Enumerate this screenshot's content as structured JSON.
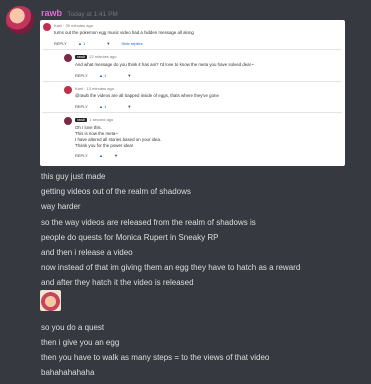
{
  "header": {
    "username": "rawb",
    "timestamp": "Today at 1:41 PM"
  },
  "card": {
    "c1": {
      "author": "Kani",
      "time": "30 minutes ago",
      "text": "turns out the pokemon egg music video had a hidden message all along",
      "reply": "REPLY",
      "likes": "1",
      "hide": "Hide replies"
    },
    "c2": {
      "author": "rawb",
      "time": "22 minutes ago",
      "text": "And what message do you think it has ani? I'd love to know the meta you have solved dear~",
      "reply": "REPLY",
      "likes": "1"
    },
    "c3": {
      "author": "Kani",
      "time": "13 minutes ago",
      "text": "@rawb the videos are all trapped inside of eggs, thats where they've gone",
      "reply": "REPLY",
      "likes": "1"
    },
    "c4": {
      "author": "rawb",
      "time": "1 second ago",
      "lines": [
        "Oh I love this.",
        "This is now the meta~",
        "I have altered all stories based on your idea.",
        "Thank you for the power idea!"
      ],
      "reply": "REPLY"
    }
  },
  "messages": [
    "this guy just made",
    "getting videos out of the realm of shadows",
    "way harder",
    "so the way videos are released from the realm of shadows is",
    "people do quests for Monica Rupert in Sneaky RP",
    "and then i release a video",
    "now instead of that im giving them an egg they have to hatch as a reward",
    "and after they hatch it the video is released"
  ],
  "messages2": [
    "so you do a quest",
    "then i give you an egg",
    "then you have to walk as many steps = to the views of that video",
    "bahahahahaha"
  ],
  "colors": {
    "background": "#36393f",
    "username": "#e06cd6",
    "text": "#dcddde",
    "timestamp": "#72767d"
  }
}
